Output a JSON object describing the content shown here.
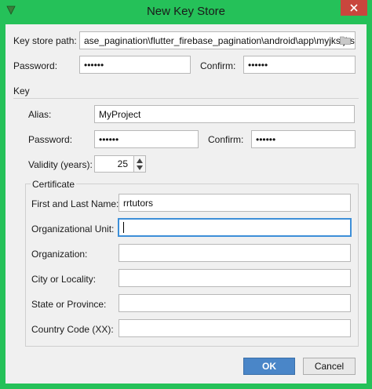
{
  "window": {
    "title": "New Key Store",
    "accent": "#25c159"
  },
  "keystore": {
    "path_label_pre": "Key store path:",
    "path_value": "ase_pagination\\flutter_firebase_pagination\\android\\app\\myjks.jks",
    "password_label": "Password:",
    "password_value": "••••••",
    "confirm_label": "Confirm:",
    "confirm_value": "••••••"
  },
  "key": {
    "section_label": "Key",
    "alias_label": "Alias:",
    "alias_value": "MyProject",
    "password_label": "Password:",
    "password_value": "••••••",
    "confirm_label": "Confirm:",
    "confirm_value": "••••••",
    "validity_label": "Validity (years):",
    "validity_value": "25"
  },
  "certificate": {
    "group_label": "Certificate",
    "first_last_label": "First and Last Name:",
    "first_last_value": "rrtutors",
    "org_unit_label": "Organizational Unit:",
    "org_unit_value": "",
    "org_label": "Organization:",
    "org_value": "",
    "city_label": "City or Locality:",
    "city_value": "",
    "state_label": "State or Province:",
    "state_value": "",
    "country_label": "Country Code (XX):",
    "country_value": ""
  },
  "buttons": {
    "ok": "OK",
    "cancel": "Cancel"
  }
}
